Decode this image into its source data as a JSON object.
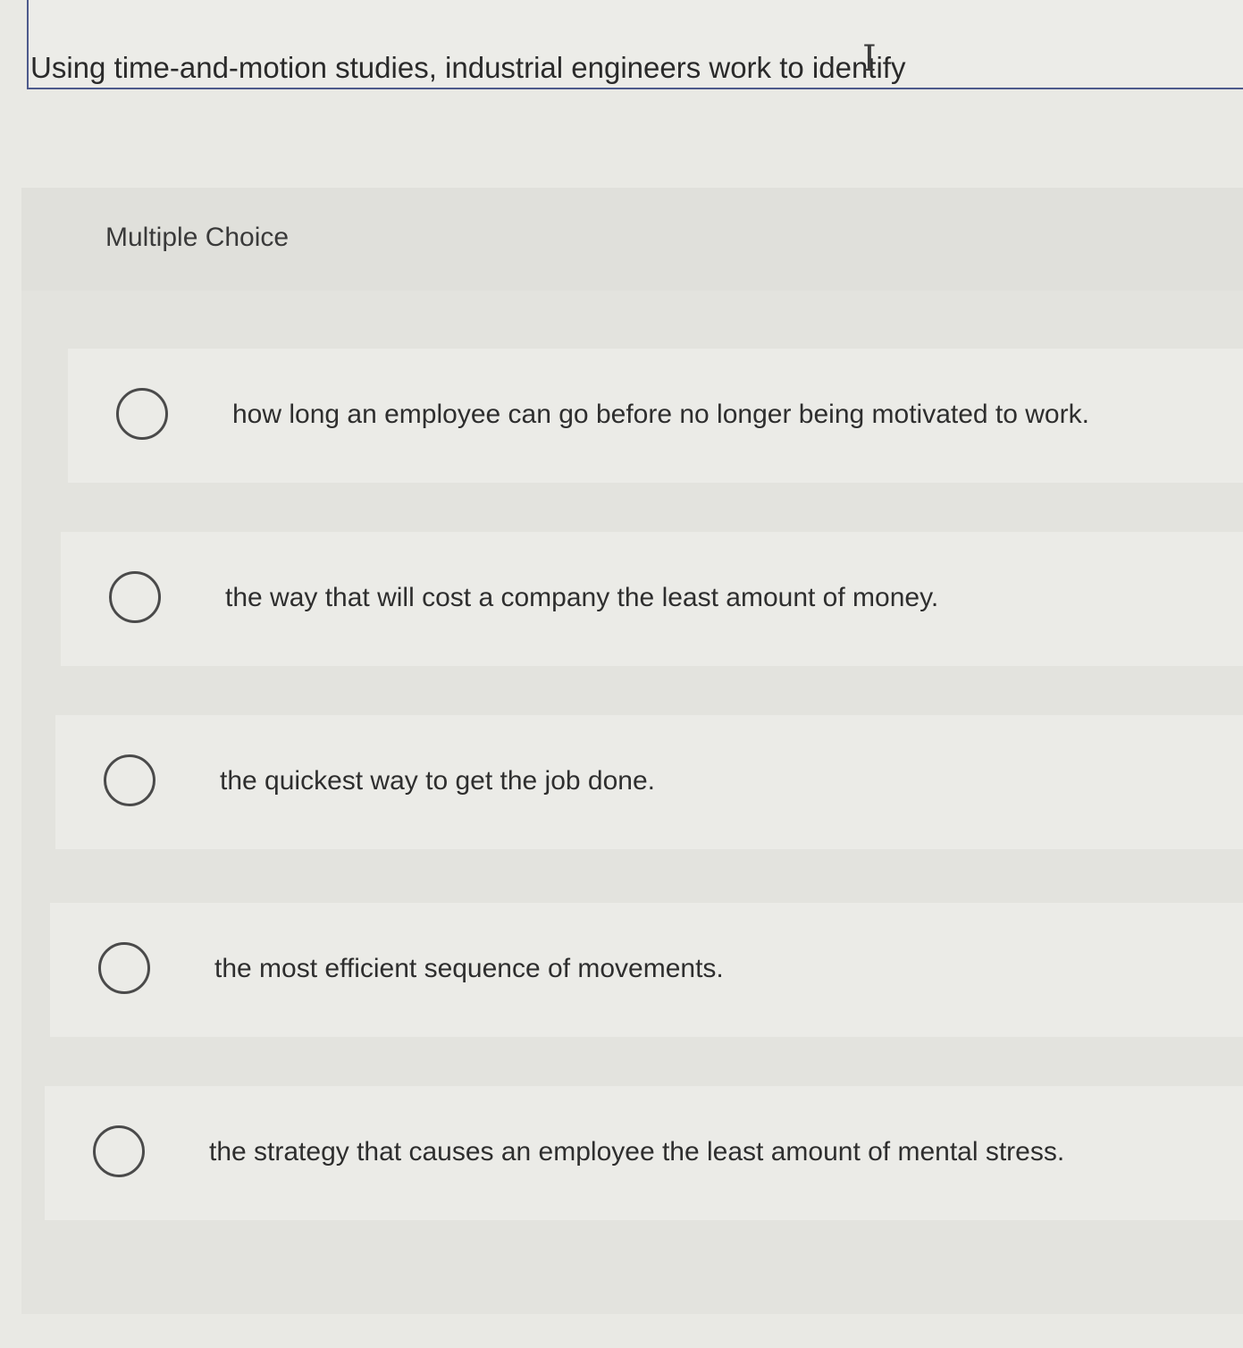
{
  "question": {
    "text": "Using time-and-motion studies, industrial engineers work to identify",
    "cursor_icon": "I"
  },
  "multiple_choice": {
    "label": "Multiple Choice",
    "options": [
      {
        "text": "how long an employee can go before no longer being motivated to work.",
        "selected": false
      },
      {
        "text": "the way that will cost a company the least amount of money.",
        "selected": false
      },
      {
        "text": "the quickest way to get the job done.",
        "selected": false
      },
      {
        "text": "the most efficient sequence of movements.",
        "selected": false
      },
      {
        "text": "the strategy that causes an employee the least amount of mental stress.",
        "selected": false
      }
    ]
  }
}
